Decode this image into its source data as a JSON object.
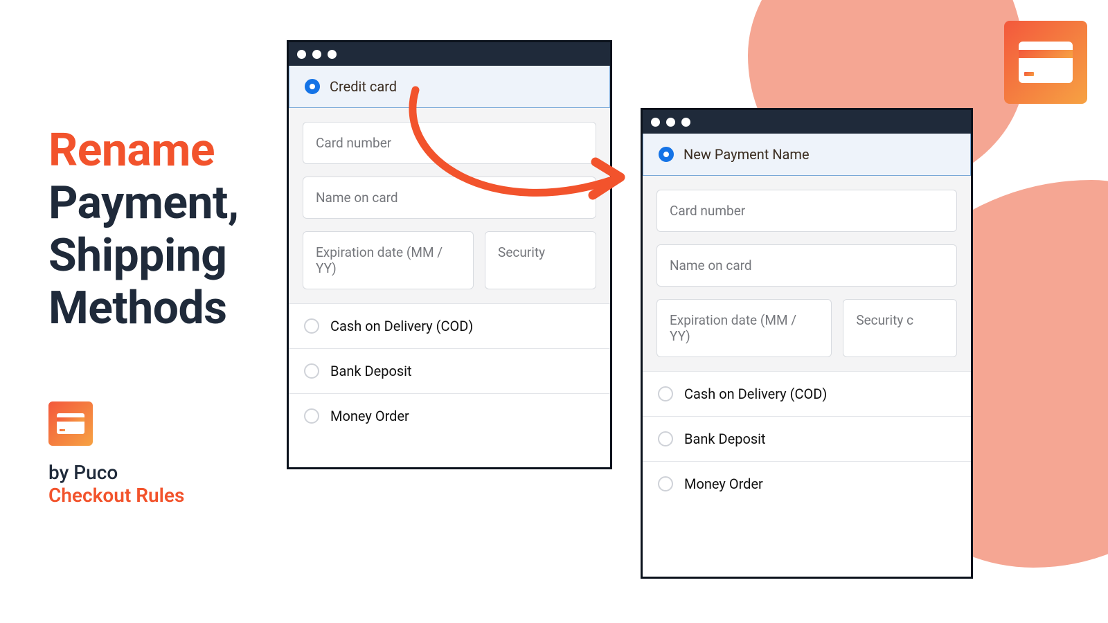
{
  "headline": {
    "accent": "Rename",
    "line2": "Payment,",
    "line3": "Shipping",
    "line4": "Methods"
  },
  "branding": {
    "line1": "by Puco",
    "line2": "Checkout Rules"
  },
  "left_window": {
    "selected_label": "Credit card",
    "fields": {
      "card_number": "Card number",
      "name_on_card": "Name on card",
      "expiration": "Expiration date (MM / YY)",
      "security": "Security"
    },
    "options": [
      "Cash on Delivery (COD)",
      "Bank Deposit",
      "Money Order"
    ]
  },
  "right_window": {
    "selected_label": "New Payment Name",
    "fields": {
      "card_number": "Card number",
      "name_on_card": "Name on card",
      "expiration": "Expiration date (MM / YY)",
      "security": "Security c"
    },
    "options": [
      "Cash on Delivery (COD)",
      "Bank Deposit",
      "Money Order"
    ]
  }
}
